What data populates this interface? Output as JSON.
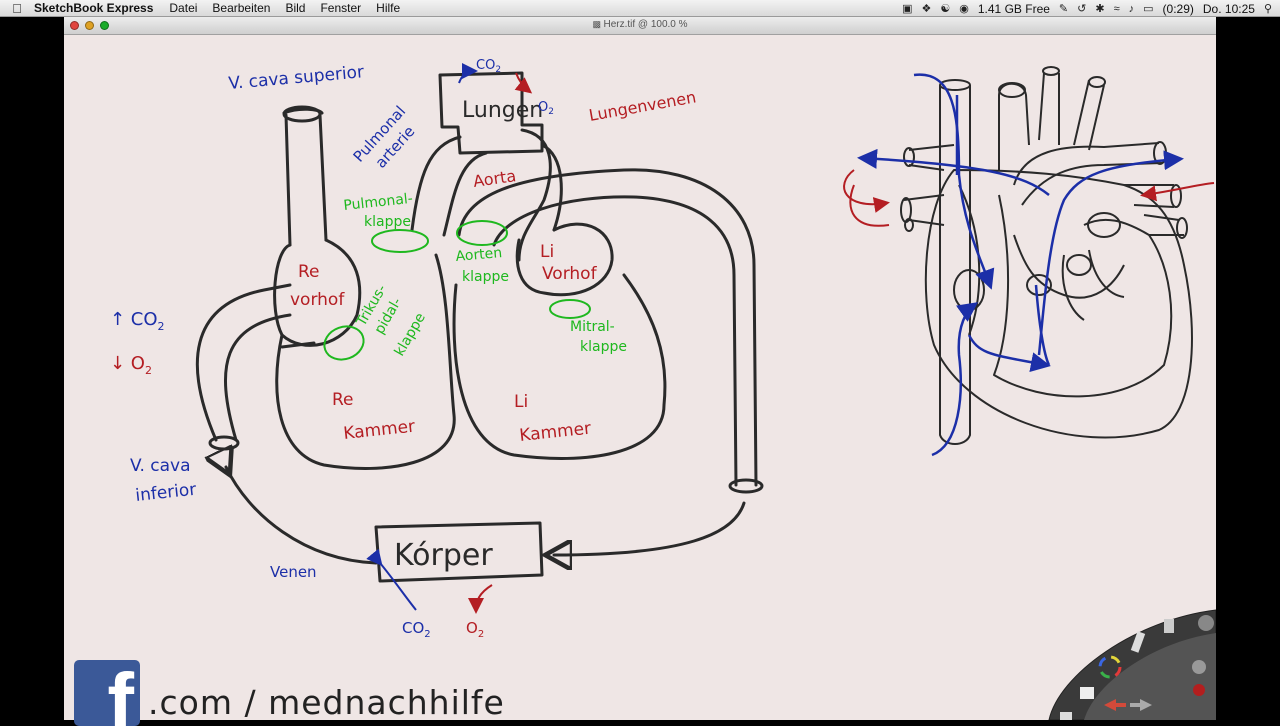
{
  "menubar": {
    "app_name": "SketchBook Express",
    "menus": [
      "Datei",
      "Bearbeiten",
      "Bild",
      "Fenster",
      "Hilfe"
    ],
    "memory": "1.41 GB Free",
    "battery": "(0:29)",
    "clock": "Do. 10:25"
  },
  "window": {
    "title": "Herz.tif @ 100.0 %"
  },
  "drawing": {
    "v_cava_superior": "V. cava superior",
    "v_cava_inferior_1": "V. cava",
    "v_cava_inferior_2": "inferior",
    "pulmonalarterie_1": "Pulmonal",
    "pulmonalarterie_2": "arterie",
    "lungen": "Lungen",
    "co2_top": "CO",
    "o2_top": "O",
    "lungenvenen": "Lungenvenen",
    "aorta": "Aorta",
    "pulmonalklappe_1": "Pulmonal-",
    "pulmonalklappe_2": "klappe",
    "aortenklappe_1": "Aorten",
    "aortenklappe_2": "klappe",
    "re_vorhof_1": "Re",
    "re_vorhof_2": "vorhof",
    "li_vorhof_1": "Li",
    "li_vorhof_2": "Vorhof",
    "trikuspidal_1": "Trikus-",
    "trikuspidal_2": "pidal-",
    "trikuspidal_3": "klappe",
    "mitral_1": "Mitral-",
    "mitral_2": "klappe",
    "re_kammer_1": "Re",
    "re_kammer_2": "Kammer",
    "li_kammer_1": "Li",
    "li_kammer_2": "Kammer",
    "koerper": "Kórper",
    "venen": "Venen",
    "co2_bottom": "CO",
    "o2_bottom": "O",
    "legend_co2": "↑ CO",
    "legend_o2": "↓ O",
    "subscript_2": "2"
  },
  "footer": {
    "fb_letter": "f",
    "url": ".com / mednachhilfe"
  },
  "colors": {
    "blue_ink": "#1c2fa8",
    "red_ink": "#b41e23",
    "green_ink": "#1fb81f",
    "black_ink": "#2a2a2a",
    "paper": "#efe6e5"
  }
}
